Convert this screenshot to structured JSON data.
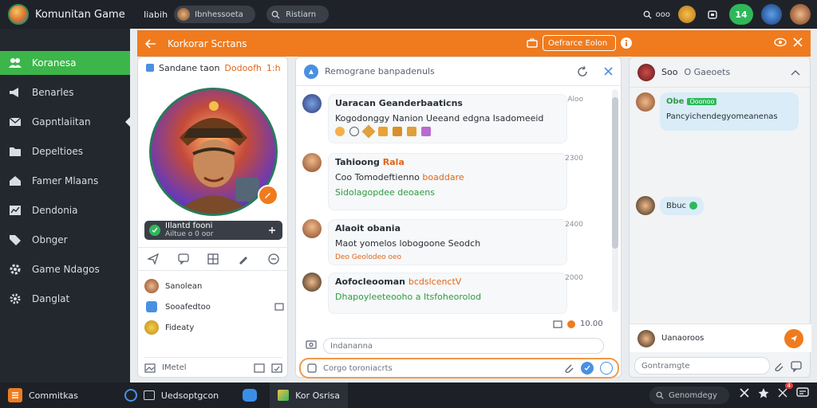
{
  "app": {
    "title": "Komunitan Game"
  },
  "topbar": {
    "user_label": "Iiabih",
    "pill1": "Ibnhessoeta",
    "pill2": "Ristiarn",
    "search_label": "ooo",
    "badge": "14"
  },
  "sidebar": {
    "items": [
      {
        "label": "Koranesa",
        "icon": "people-icon"
      },
      {
        "label": "Benarles",
        "icon": "megaphone-icon"
      },
      {
        "label": "Gapntlaiitan",
        "icon": "mail-icon"
      },
      {
        "label": "Depeltioes",
        "icon": "folder-icon"
      },
      {
        "label": "Famer Mlaans",
        "icon": "home-icon"
      },
      {
        "label": "Dendonia",
        "icon": "chart-icon"
      },
      {
        "label": "Obnger",
        "icon": "tag-icon"
      },
      {
        "label": "Game Ndagos",
        "icon": "gear-icon"
      },
      {
        "label": "Danglat",
        "icon": "settings-icon"
      }
    ]
  },
  "header": {
    "title": "Korkorar Scrtans",
    "search": "Oefrarce Eolon"
  },
  "left_panel": {
    "head_label": "Sandane taon",
    "head_accent": "Dodoofh",
    "head_suffix": "1:h",
    "status_label": "IIlantd fooni",
    "status_sub": "Ailtue o 0 oor",
    "list": [
      {
        "label": "Sanolean"
      },
      {
        "label": "Sooafedtoo"
      },
      {
        "label": "Fideaty"
      }
    ],
    "footer_label": "IMetel"
  },
  "chat": {
    "search_placeholder": "Remograne banpadenuls",
    "messages": [
      {
        "name": "Uaracan Geanderbaaticns",
        "time": "Aloo",
        "line1": "Kogodonggy Nanion Ueeand edgna Isadomeeid"
      },
      {
        "name": "Tahioong",
        "name_accent": "Rala",
        "time": "2300",
        "line1": "Coo Tomodeftienno",
        "line1_accent": "boaddare",
        "line2": "Sidolagopdee deoaens"
      },
      {
        "name": "Alaoit obania",
        "time": "2400",
        "line1": "Maot yomelos lobogoone Seodch",
        "line2": "Deo Geolodeo oeo"
      },
      {
        "name": "Aofocleooman",
        "name_accent": "bcdslcenctV",
        "time": "2000",
        "line1": "Dhapoyleeteooho a Itsfoheorolod"
      }
    ],
    "meta_time": "10.00",
    "input1_placeholder": "Indananna",
    "input2_placeholder": "Corgo toroniacrts"
  },
  "right_panel": {
    "head_label": "Soo",
    "head_sub": "O Gaeoets",
    "msg1_name": "Obe",
    "msg1_tag": "Ooonoo",
    "msg1_text": "Pancyichendegyomeanenas",
    "msg2_text": "Bbuc",
    "footer_label": "Uanaoroos",
    "input_placeholder": "Gontramgte"
  },
  "taskbar": {
    "start_label": "Commitkas",
    "item1": "Uedsoptgcon",
    "item2": "Kor Osrisa",
    "search_label": "Genomdegy",
    "badge": "4"
  },
  "colors": {
    "accent": "#ef7b1e",
    "sidebar_active": "#3cb64a",
    "sidebar_bg": "#23272e",
    "chat_bubble": "#d9ecf7"
  }
}
